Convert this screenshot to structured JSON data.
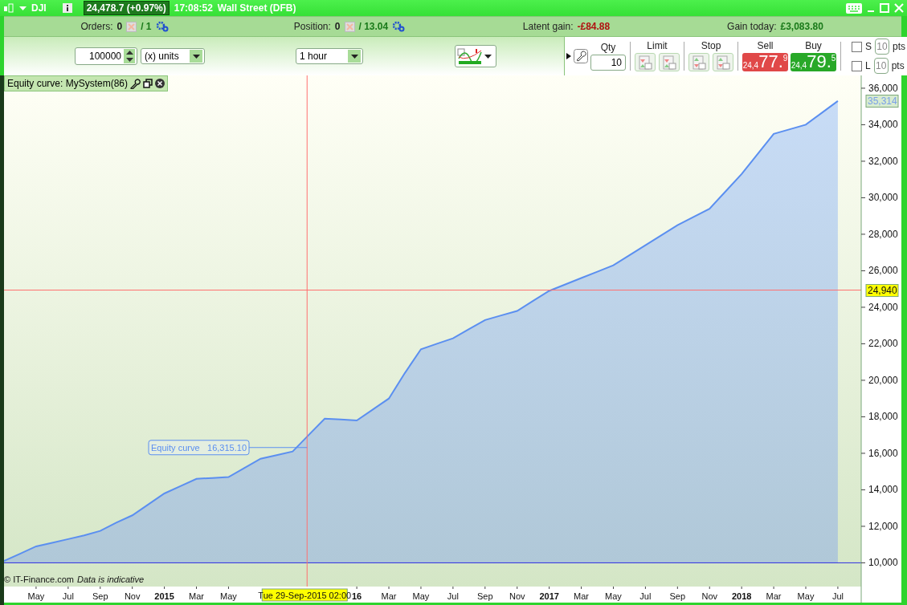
{
  "title_bar": {
    "instrument": "DJI",
    "price": "24,478.7 (+0.97%)",
    "time": "17:08:52",
    "market": "Wall Street (DFB)"
  },
  "info_bar": [
    {
      "label": "Orders:",
      "value": "0",
      "total": "/ 1",
      "kind": "orders"
    },
    {
      "label": "Position:",
      "value": "0",
      "total": "/ 13.04",
      "kind": "orders"
    },
    {
      "label": "Latent gain:",
      "value": "-£84.88",
      "color": "#b01010",
      "kind": "gain"
    },
    {
      "label": "Gain today:",
      "value": "£3,083.80",
      "color": "#1a7a1a",
      "kind": "gain"
    }
  ],
  "toolbar": {
    "quantity": "100000",
    "unit": "(x) units",
    "timeframe": "1 hour"
  },
  "order_ticket": {
    "qty_label": "Qty",
    "qty": "10",
    "limit_label": "Limit",
    "stop_label": "Stop",
    "sides": [
      {
        "kind": "sell",
        "label": "Sell",
        "prefix": "24,4",
        "big": "77.",
        "sup": "9"
      },
      {
        "kind": "buy",
        "label": "Buy",
        "prefix": "24,4",
        "big": "79.",
        "sup": "5"
      }
    ],
    "stops": [
      {
        "label": "S",
        "value": "10",
        "unit": "pts",
        "checked": false
      },
      {
        "label": "L",
        "value": "10",
        "unit": "pts",
        "checked": false
      }
    ]
  },
  "chart": {
    "panel_title": "Equity curve: MySystem(86)",
    "copyright": "© IT-Finance.com",
    "disclaimer": "Data is indicative",
    "crosshair_price": "24,940",
    "crosshair_date": "Tue 29-Sep-2015 02:00",
    "last_value": "35,314",
    "tooltip_value": "16,315.10",
    "chart_data": {
      "type": "area",
      "categories": [
        null,
        null,
        "May",
        null,
        "Jul",
        null,
        "Sep",
        null,
        "Nov",
        null,
        "2015",
        null,
        "Mar",
        null,
        "May",
        null,
        null,
        null,
        null,
        null,
        null,
        null,
        "16",
        null,
        "Mar",
        null,
        "May",
        null,
        "Jul",
        null,
        "Sep",
        null,
        "Nov",
        null,
        "2017",
        null,
        "Mar",
        null,
        "May",
        null,
        "Jul",
        null,
        "Sep",
        null,
        "Nov",
        null,
        "2018",
        null,
        "Mar",
        null,
        "May",
        null,
        "Jul"
      ],
      "series": [
        {
          "name": "Equity curve",
          "color": "#5b8ff0",
          "values": [
            10100,
            10500,
            10900,
            11100,
            11300,
            11500,
            11750,
            12200,
            12600,
            13200,
            13800,
            14200,
            14600,
            14650,
            14700,
            15200,
            15700,
            15900,
            16100,
            17000,
            17900,
            17850,
            17800,
            18400,
            19000,
            20400,
            21700,
            22000,
            22300,
            22800,
            23300,
            23550,
            23800,
            24350,
            24900,
            25250,
            25600,
            25950,
            26300,
            26850,
            27400,
            27950,
            28500,
            28950,
            29400,
            30350,
            31300,
            32400,
            33500,
            33750,
            34000,
            34650,
            35300
          ]
        }
      ],
      "ylim": [
        8700,
        36700
      ],
      "ref_lines": [
        {
          "axis": "y",
          "value": 10000,
          "color": "#3030e0"
        },
        {
          "axis": "y",
          "value": 24940,
          "color": "#ff7070"
        }
      ],
      "yticks": [
        {
          "value": 10000,
          "label": "10,000"
        },
        {
          "value": 12000,
          "label": "12,000"
        },
        {
          "value": 14000,
          "label": "14,000"
        },
        {
          "value": 16000,
          "label": "16,000"
        },
        {
          "value": 18000,
          "label": "18,000"
        },
        {
          "value": 20000,
          "label": "20,000"
        },
        {
          "value": 22000,
          "label": "22,000"
        },
        {
          "value": 24000,
          "label": "24,000"
        },
        {
          "value": 26000,
          "label": "26,000"
        },
        {
          "value": 28000,
          "label": "28,000"
        },
        {
          "value": 30000,
          "label": "30,000"
        },
        {
          "value": 32000,
          "label": "32,000"
        },
        {
          "value": 34000,
          "label": "34,000"
        },
        {
          "value": 36000,
          "label": "36,000"
        }
      ]
    }
  }
}
